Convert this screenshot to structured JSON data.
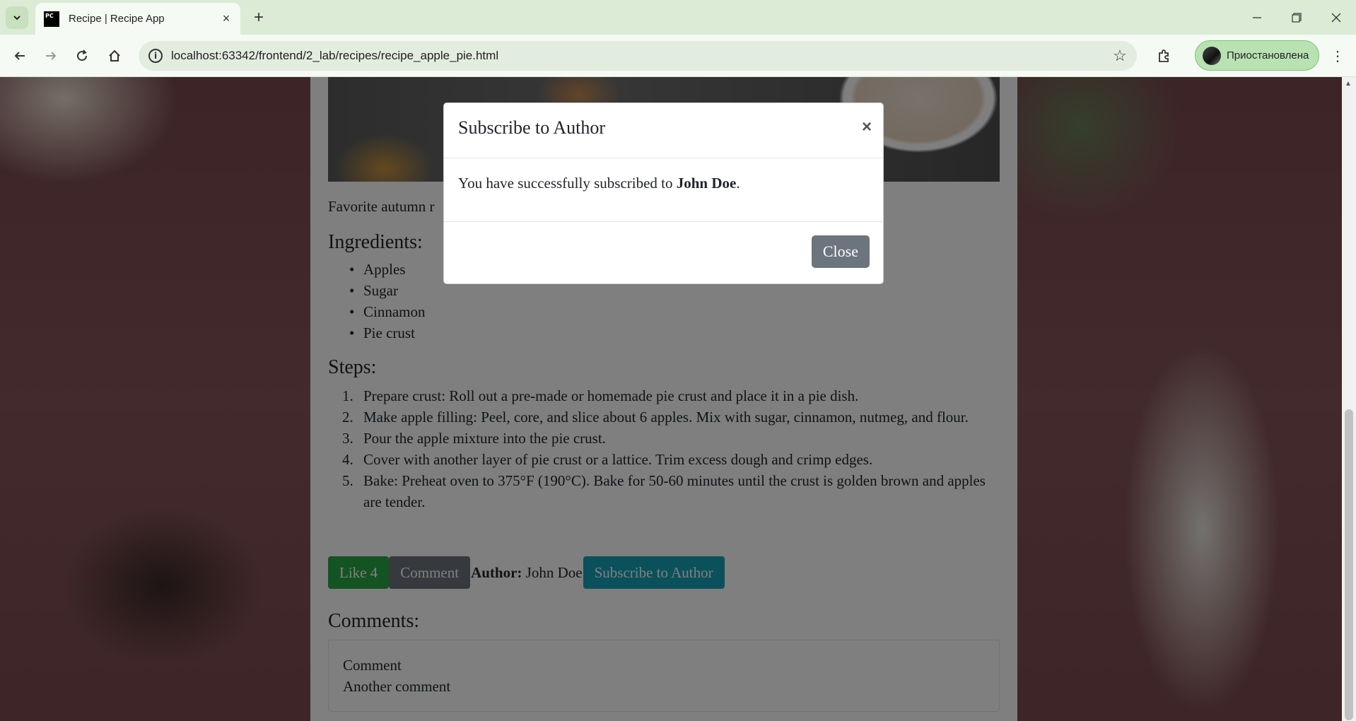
{
  "browser": {
    "tab_title": "Recipe | Recipe App",
    "favicon_text": "PC",
    "url": "localhost:63342/frontend/2_lab/recipes/recipe_apple_pie.html",
    "profile_label": "Приостановлена"
  },
  "recipe": {
    "description": "Favorite autumn r",
    "ingredients_heading": "Ingredients:",
    "ingredients": [
      "Apples",
      "Sugar",
      "Cinnamon",
      "Pie crust"
    ],
    "steps_heading": "Steps:",
    "steps": [
      "Prepare crust: Roll out a pre-made or homemade pie crust and place it in a pie dish.",
      "Make apple filling: Peel, core, and slice about 6 apples. Mix with sugar, cinnamon, nutmeg, and flour.",
      "Pour the apple mixture into the pie crust.",
      "Cover with another layer of pie crust or a lattice. Trim excess dough and crimp edges.",
      "Bake: Preheat oven to 375°F (190°C). Bake for 50-60 minutes until the crust is golden brown and apples are tender."
    ],
    "like_label": "Like 4",
    "comment_label": "Comment",
    "author_label": "Author:",
    "author_name": "John Doe",
    "subscribe_label": "Subscribe to Author",
    "comments_heading": "Comments:",
    "comments": [
      "Comment",
      "Another comment"
    ]
  },
  "modal": {
    "title": "Subscribe to Author",
    "close_x": "×",
    "message_prefix": "You have successfully subscribed to",
    "message_name": "John Doe",
    "message_suffix": ".",
    "close_label": "Close"
  }
}
